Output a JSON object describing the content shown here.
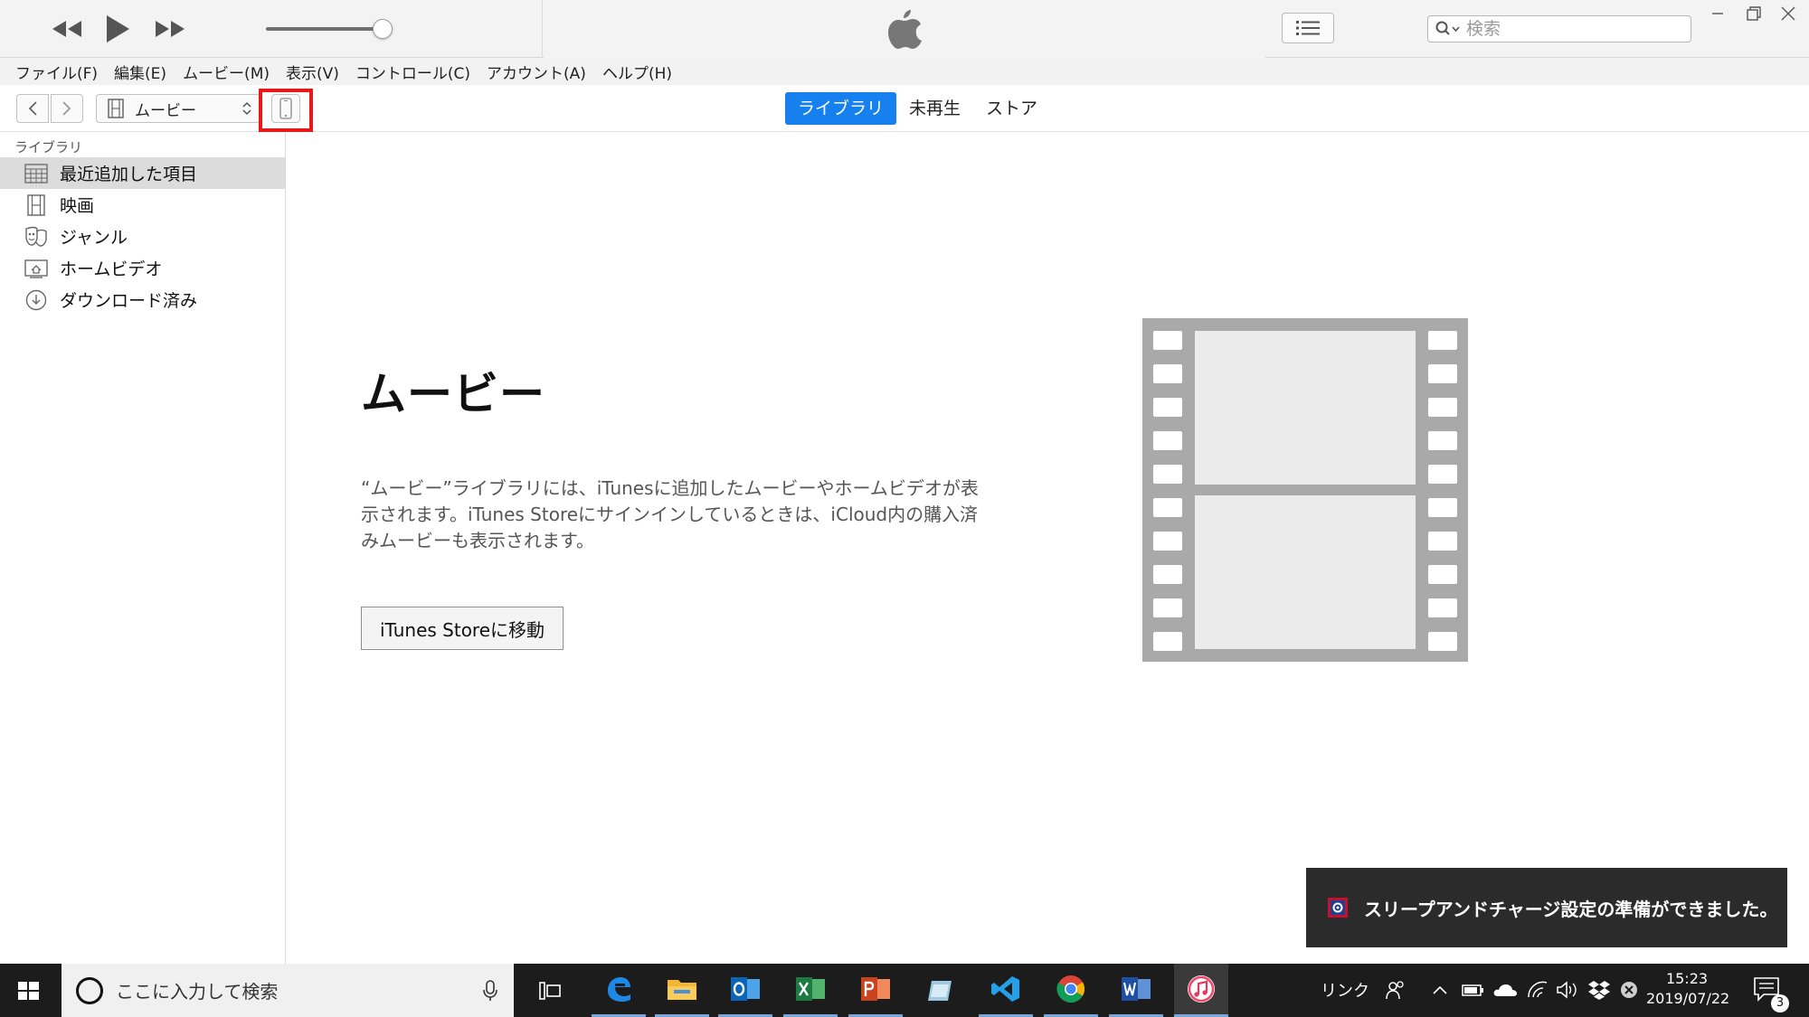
{
  "player": {
    "volume_level": 0.92
  },
  "search": {
    "placeholder": "検索"
  },
  "menubar": {
    "items": [
      "ファイル(F)",
      "編集(E)",
      "ムービー(M)",
      "表示(V)",
      "コントロール(C)",
      "アカウント(A)",
      "ヘルプ(H)"
    ]
  },
  "nav": {
    "media_kind": "ムービー",
    "tabs": [
      {
        "label": "ライブラリ",
        "active": true
      },
      {
        "label": "未再生",
        "active": false
      },
      {
        "label": "ストア",
        "active": false
      }
    ],
    "highlight_color": "#e81818"
  },
  "sidebar": {
    "heading": "ライブラリ",
    "items": [
      {
        "label": "最近追加した項目",
        "icon": "grid-icon",
        "selected": true
      },
      {
        "label": "映画",
        "icon": "film-icon",
        "selected": false
      },
      {
        "label": "ジャンル",
        "icon": "masks-icon",
        "selected": false
      },
      {
        "label": "ホームビデオ",
        "icon": "home-video-icon",
        "selected": false
      },
      {
        "label": "ダウンロード済み",
        "icon": "download-icon",
        "selected": false
      }
    ]
  },
  "main": {
    "title": "ムービー",
    "description": "“ムービー”ライブラリには、iTunesに追加したムービーやホームビデオが表示されます。iTunes Storeにサインインしているときは、iCloud内の購入済みムービーも表示されます。",
    "store_button": "iTunes Storeに移動"
  },
  "toast": {
    "message": "スリープアンドチャージ設定の準備ができました。"
  },
  "taskbar": {
    "search_placeholder": "ここに入力して検索",
    "links_label": "リンク",
    "time": "15:23",
    "date": "2019/07/22",
    "notification_count": "3",
    "apps": [
      "task-view",
      "edge",
      "file-explorer",
      "outlook",
      "excel",
      "powerpoint",
      "notes-app",
      "vscode",
      "chrome",
      "word",
      "itunes"
    ]
  },
  "colors": {
    "accent": "#1681ee",
    "taskbar": "#1c1c1c",
    "toast": "#2b2b2b"
  }
}
